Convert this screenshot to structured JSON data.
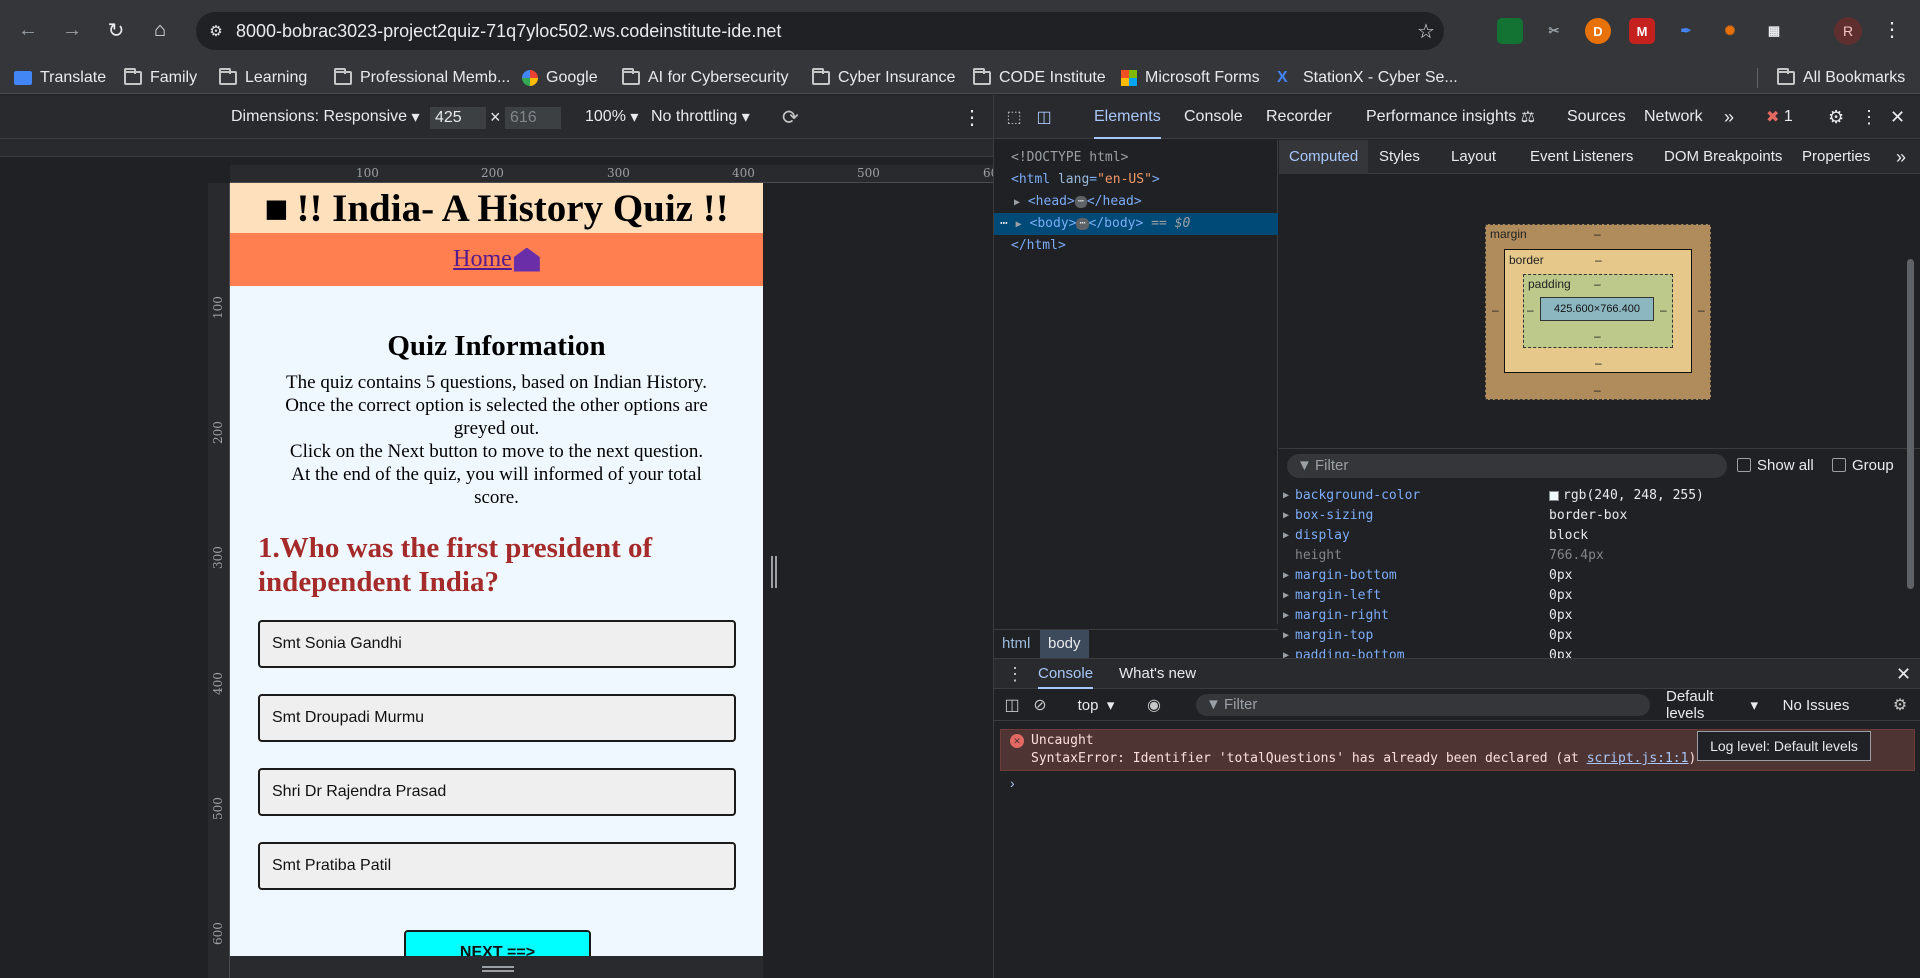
{
  "browser": {
    "url": "8000-bobrac3023-project2quiz-71q7yloc502.ws.codeinstitute-ide.net",
    "profile_initial": "R",
    "bookmarks": [
      {
        "label": "Translate",
        "icon": "translate-icon"
      },
      {
        "label": "Family",
        "icon": "folder-icon"
      },
      {
        "label": "Learning",
        "icon": "folder-icon"
      },
      {
        "label": "Professional Memb...",
        "icon": "folder-icon"
      },
      {
        "label": "Google",
        "icon": "google-icon"
      },
      {
        "label": "AI for Cybersecurity",
        "icon": "folder-icon"
      },
      {
        "label": "Cyber Insurance",
        "icon": "folder-icon"
      },
      {
        "label": "CODE Institute",
        "icon": "folder-icon"
      },
      {
        "label": "Microsoft Forms",
        "icon": "microsoft-icon"
      },
      {
        "label": "StationX - Cyber Se...",
        "icon": "stationx-icon"
      }
    ],
    "all_bookmarks": "All Bookmarks"
  },
  "device_toolbar": {
    "dimensions": "Dimensions: Responsive",
    "width": "425",
    "height": "616",
    "times": "×",
    "zoom": "100%",
    "throttling": "No throttling"
  },
  "rulers": {
    "h": [
      "100",
      "200",
      "300",
      "400",
      "500",
      "60"
    ],
    "v": [
      "100",
      "200",
      "300",
      "400",
      "500",
      "600"
    ]
  },
  "quiz_page": {
    "header": "!! India- A History Quiz !!",
    "nav_home": "Home",
    "title": "Quiz Information",
    "info_lines": [
      "The quiz contains 5 questions, based on Indian History.",
      "Once the correct option is selected the other options are",
      "greyed out.",
      "Click on the Next button to move to the next question.",
      "At the end of the quiz, you will informed of your total",
      "score."
    ],
    "question_line1": "1.Who was the first president of",
    "question_line2": "independent India?",
    "options": [
      "Smt Sonia Gandhi",
      "Smt Droupadi Murmu",
      "Shri Dr Rajendra Prasad",
      "Smt Pratiba Patil"
    ],
    "next_button": "NEXT ==>"
  },
  "devtools": {
    "tabs": [
      "Elements",
      "Console",
      "Recorder",
      "Performance insights",
      "Sources",
      "Network"
    ],
    "active_tab": "Elements",
    "error_count": "1",
    "dom": {
      "doctype": "<!DOCTYPE html>",
      "html_open": "<html",
      "lang_attr": "lang",
      "lang_val": "\"en-US\"",
      "head": "<head>",
      "head_close": "</head>",
      "body": "<body>",
      "body_close": "</body>",
      "eq": "== $0",
      "html_close": "</html>"
    },
    "breadcrumbs": [
      "html",
      "body"
    ],
    "side_tabs": [
      "Computed",
      "Styles",
      "Layout",
      "Event Listeners",
      "DOM Breakpoints",
      "Properties"
    ],
    "box_model": {
      "margin": "margin",
      "border": "border",
      "padding": "padding",
      "dash": "–",
      "content": "425.600×766.400"
    },
    "filter_placeholder": "Filter",
    "show_all": "Show all",
    "group": "Group",
    "computed": [
      {
        "name": "background-color",
        "value": "rgb(240, 248, 255)",
        "dim": false,
        "swatch": true
      },
      {
        "name": "box-sizing",
        "value": "border-box",
        "dim": false
      },
      {
        "name": "display",
        "value": "block",
        "dim": false
      },
      {
        "name": "height",
        "value": "766.4px",
        "dim": true
      },
      {
        "name": "margin-bottom",
        "value": "0px",
        "dim": false
      },
      {
        "name": "margin-left",
        "value": "0px",
        "dim": false
      },
      {
        "name": "margin-right",
        "value": "0px",
        "dim": false
      },
      {
        "name": "margin-top",
        "value": "0px",
        "dim": false
      },
      {
        "name": "padding-bottom",
        "value": "0px",
        "dim": false
      }
    ],
    "drawer": {
      "tabs": [
        "Console",
        "What's new"
      ],
      "context": "top",
      "filter": "Filter",
      "levels": "Default levels",
      "issues": "No Issues",
      "error_title": "Uncaught",
      "error_msg": "SyntaxError: Identifier 'totalQuestions' has already been declared (at ",
      "error_link": "script.js:1:1",
      "error_tail": ")",
      "tooltip": "Log level: Default levels",
      "prompt": "›"
    }
  }
}
